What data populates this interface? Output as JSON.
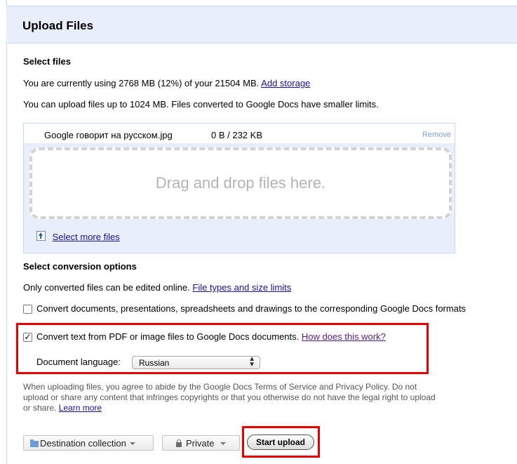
{
  "header": {
    "title": "Upload Files"
  },
  "select_files": {
    "heading": "Select files",
    "usage_text": "You are currently using 2768 MB (12%) of your 21504 MB.",
    "add_storage_link": "Add storage",
    "limit_text": "You can upload files up to 1024 MB. Files converted to Google Docs have smaller limits."
  },
  "file_list": {
    "items": [
      {
        "name": "Google говорит на русском.jpg",
        "progress": "0 B / 232 KB",
        "remove_label": "Remove"
      }
    ],
    "dropzone_text": "Drag and drop files here.",
    "select_more_link": "Select more files"
  },
  "conversion": {
    "heading": "Select conversion options",
    "only_converted_text": "Only converted files can be edited online.",
    "file_types_link": "File types and size limits",
    "option_convert_docs": {
      "label": "Convert documents, presentations, spreadsheets and drawings to the corresponding Google Docs formats",
      "checked": false
    },
    "option_ocr": {
      "label": "Convert text from PDF or image files to Google Docs documents.",
      "checked": true,
      "check_glyph": "✓"
    },
    "how_link": "How does this work?",
    "language_label": "Document language:",
    "language_value": "Russian",
    "select_arrows": "▲▼"
  },
  "terms": {
    "text": "When uploading files, you agree to abide by the Google Docs Terms of Service and Privacy Policy. Do not upload or share any content that infringes copyrights or that you otherwise do not have the legal right to upload or share.",
    "learn_more_link": "Learn more"
  },
  "actions": {
    "destination_label": "Destination collection",
    "privacy_label": "Private",
    "start_label": "Start upload"
  },
  "colors": {
    "accent_red": "#e60000",
    "link_blue": "#1a0dab",
    "header_bg": "#e8eefa",
    "border_blue": "#c3d9ff"
  }
}
